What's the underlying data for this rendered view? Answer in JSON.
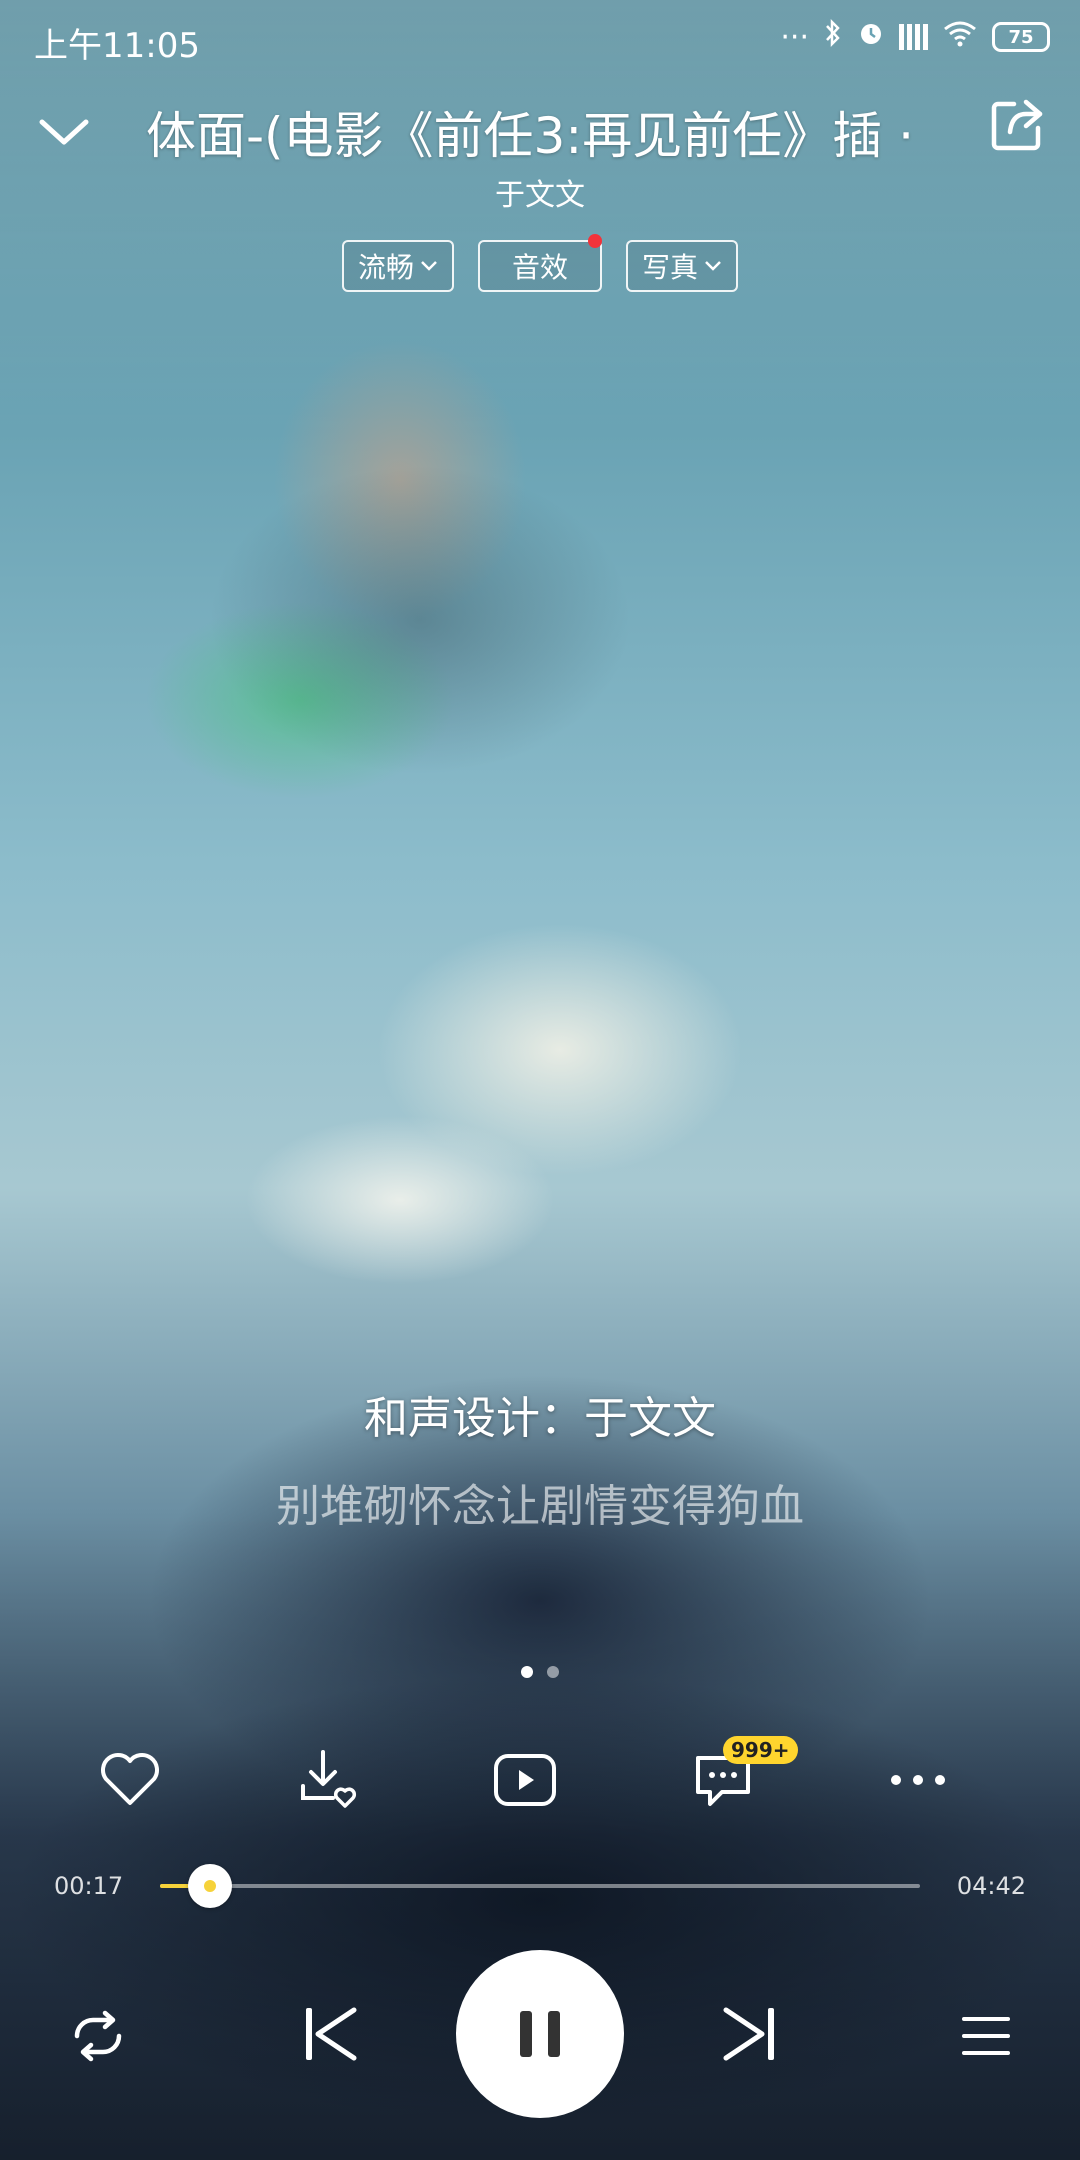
{
  "status_bar": {
    "time": "上午11:05",
    "dots": "···",
    "battery": "75"
  },
  "header": {
    "title": "体面-(电影《前任3:再见前任》插 · ·",
    "artist": "于文文"
  },
  "options": [
    {
      "label": "流畅",
      "has_chevron": true
    },
    {
      "label": "音效",
      "has_red_dot": true
    },
    {
      "label": "写真",
      "has_chevron": true
    }
  ],
  "lyrics": {
    "current": "和声设计：于文文",
    "next": "别堆砌怀念让剧情变得狗血"
  },
  "actions": {
    "comment_badge": "999+"
  },
  "progress": {
    "current_time": "00:17",
    "total_time": "04:42",
    "fraction": 0.066
  },
  "colors": {
    "accent": "#f6d23a",
    "red_dot": "#f2333b"
  }
}
